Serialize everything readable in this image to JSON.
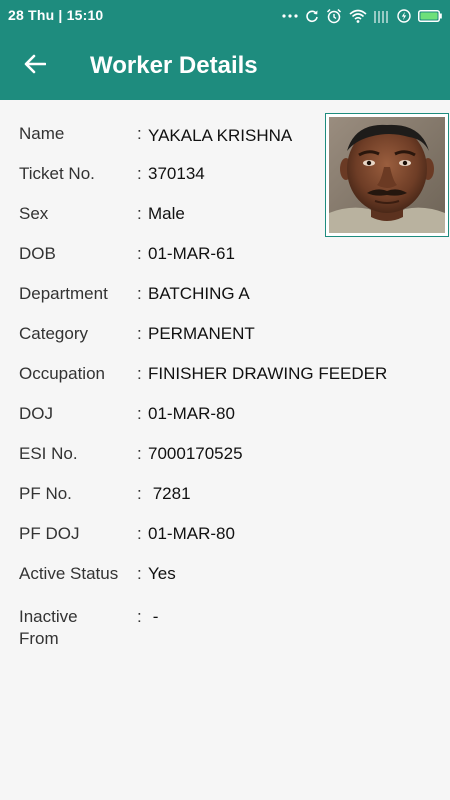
{
  "status_bar": {
    "time": "28 Thu  |  15:10",
    "icons": [
      "more-dots-icon",
      "sync-icon",
      "alarm-icon",
      "wifi-icon",
      "signal-icon",
      "charging-icon",
      "battery-icon"
    ]
  },
  "app_bar": {
    "back_icon": "arrow-left-icon",
    "title": "Worker Details"
  },
  "colors": {
    "primary": "#1e8c7e",
    "background": "#f6f6f6",
    "text": "#222222"
  },
  "worker": {
    "fields": [
      {
        "label": "Name",
        "value": " YAKALA KRISHNA"
      },
      {
        "label": "Ticket No.",
        "value": "370134"
      },
      {
        "label": "Sex",
        "value": "Male"
      },
      {
        "label": "DOB",
        "value": "01-MAR-61"
      },
      {
        "label": "Department",
        "value": "BATCHING A"
      },
      {
        "label": "Category",
        "value": "PERMANENT"
      },
      {
        "label": "Occupation",
        "value": "FINISHER DRAWING FEEDER"
      },
      {
        "label": "DOJ",
        "value": "01-MAR-80"
      },
      {
        "label": "ESI No.",
        "value": "7000170525"
      },
      {
        "label": "PF No.",
        "value": " 7281"
      },
      {
        "label": "PF DOJ",
        "value": "01-MAR-80"
      },
      {
        "label": "Active Status",
        "value": "Yes"
      },
      {
        "label": "Inactive From",
        "value": " -"
      }
    ],
    "colon": ":"
  }
}
